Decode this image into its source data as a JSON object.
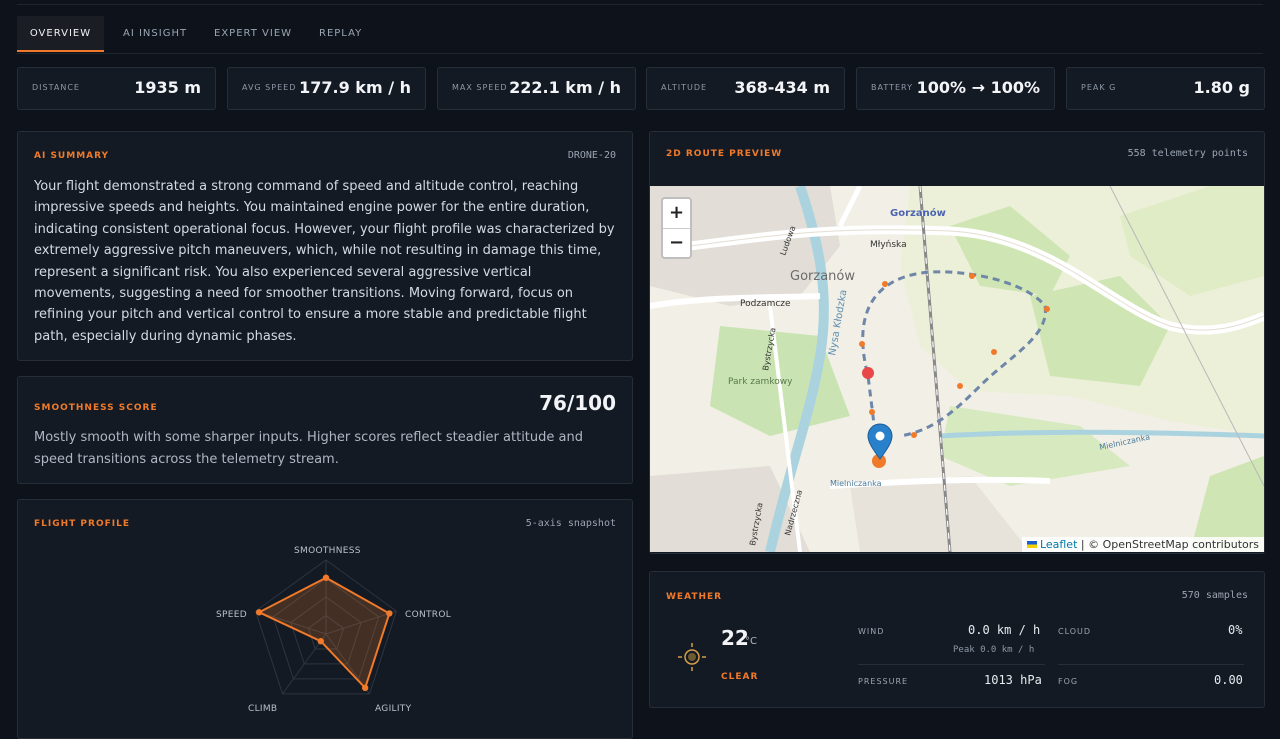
{
  "tabs": [
    {
      "label": "OVERVIEW",
      "active": true
    },
    {
      "label": "AI INSIGHT",
      "active": false
    },
    {
      "label": "EXPERT VIEW",
      "active": false
    },
    {
      "label": "REPLAY",
      "active": false
    }
  ],
  "stats": [
    {
      "label": "DISTANCE",
      "value": "1935 m"
    },
    {
      "label": "AVG SPEED",
      "value": "177.9 km / h"
    },
    {
      "label": "MAX SPEED",
      "value": "222.1 km / h"
    },
    {
      "label": "ALTITUDE",
      "value": "368-434 m"
    },
    {
      "label": "BATTERY",
      "value": "100% → 100%"
    },
    {
      "label": "PEAK G",
      "value": "1.80 g"
    }
  ],
  "ai_summary": {
    "title": "AI SUMMARY",
    "model": "DRONE-20",
    "text": "Your flight demonstrated a strong command of speed and altitude control, reaching impressive speeds and heights. You maintained engine power for the entire duration, indicating consistent operational focus. However, your flight profile was characterized by extremely aggressive pitch maneuvers, which, while not resulting in damage this time, represent a significant risk. You also experienced several aggressive vertical movements, suggesting a need for smoother transitions. Moving forward, focus on refining your pitch and vertical control to ensure a more stable and predictable flight path, especially during dynamic phases."
  },
  "smoothness": {
    "title": "SMOOTHNESS SCORE",
    "score": "76/100",
    "text": "Mostly smooth with some sharper inputs. Higher scores reflect steadier attitude and speed transitions across the telemetry stream."
  },
  "flight_profile": {
    "title": "FLIGHT PROFILE",
    "meta": "5-axis snapshot",
    "axes": [
      {
        "label": "SMOOTHNESS",
        "value": 0.76
      },
      {
        "label": "CONTROL",
        "value": 0.9
      },
      {
        "label": "AGILITY",
        "value": 0.9
      },
      {
        "label": "CLIMB",
        "value": 0.12
      },
      {
        "label": "SPEED",
        "value": 0.95
      }
    ]
  },
  "route": {
    "title": "2D ROUTE PREVIEW",
    "meta": "558 telemetry points",
    "zoom_in": "+",
    "zoom_out": "−",
    "attr_leaflet": "Leaflet",
    "attr_rest": " | © OpenStreetMap contributors",
    "places": {
      "town_label": "Gorzanów",
      "town_label2": "Gorzanów",
      "street1": "Młyńska",
      "street2": "Podzamcze",
      "street3": "Ludowa",
      "street4": "Bystrzycka",
      "park": "Park zamkowy",
      "river": "Nysa Kłodzka",
      "creek1": "Mielniczanka",
      "creek2": "Mielniczanka",
      "street5": "Młyńska",
      "street6": "Nadrzeczna",
      "street7": "Bystrzycka"
    }
  },
  "weather": {
    "title": "WEATHER",
    "meta": "570 samples",
    "temp": "22",
    "unit": "°C",
    "condition": "CLEAR",
    "wind_label": "WIND",
    "wind_value": "0.0 km / h",
    "wind_peak": "Peak 0.0 km / h",
    "cloud_label": "CLOUD",
    "cloud_value": "0%",
    "pressure_label": "PRESSURE",
    "pressure_value": "1013 hPa",
    "fog_label": "FOG",
    "fog_value": "0.00"
  },
  "colors": {
    "accent": "#f07a2a",
    "bg": "#0e131b",
    "panel": "#141a23"
  }
}
